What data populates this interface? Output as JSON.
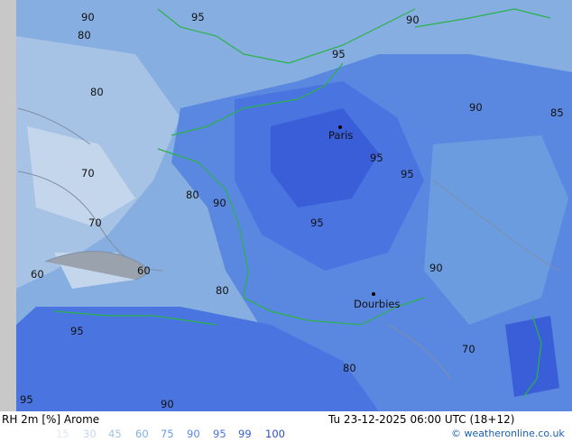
{
  "footer": {
    "title": "RH 2m [%] Arome",
    "datetime": "Tu 23-12-2025 06:00 UTC (18+12)",
    "credit": "© weatheronline.co.uk"
  },
  "legend": [
    {
      "label": "15",
      "color": "#e0e8f4"
    },
    {
      "label": "30",
      "color": "#c4d6ec"
    },
    {
      "label": "45",
      "color": "#a6c2e4"
    },
    {
      "label": "60",
      "color": "#86aee0"
    },
    {
      "label": "75",
      "color": "#6c9ce0"
    },
    {
      "label": "90",
      "color": "#5a88e0"
    },
    {
      "label": "95",
      "color": "#4a74e0"
    },
    {
      "label": "99",
      "color": "#3a5ed8"
    },
    {
      "label": "100",
      "color": "#2e4ec8"
    }
  ],
  "map": {
    "cities": [
      "Paris",
      "Dourbies"
    ],
    "contour_labels": [
      "90",
      "95",
      "80",
      "70",
      "60",
      "85",
      "90",
      "95",
      "80",
      "95",
      "90",
      "80",
      "70",
      "95",
      "90",
      "80",
      "60",
      "70",
      "95",
      "90",
      "80",
      "95",
      "90",
      "95"
    ]
  }
}
